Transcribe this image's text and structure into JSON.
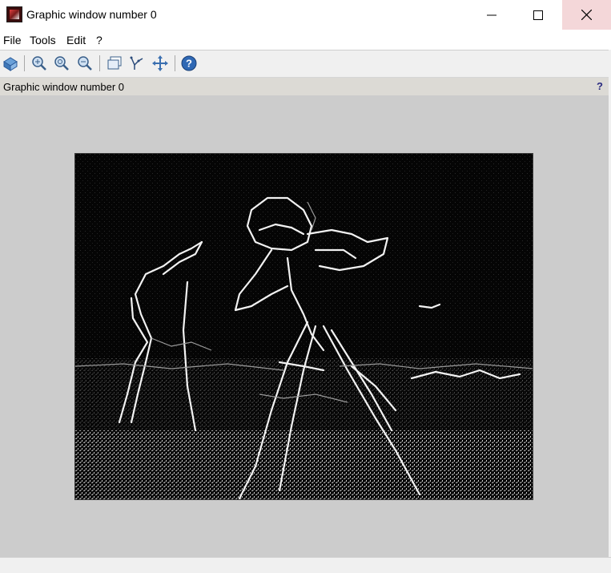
{
  "window": {
    "title": "Graphic window number 0"
  },
  "menu": {
    "items": [
      "File",
      "Tools",
      "Edit",
      "?"
    ]
  },
  "toolbar": {
    "icons": [
      "rotate-3d-icon",
      "zoom-in-icon",
      "zoom-original-icon",
      "zoom-out-icon",
      "datatip-icon",
      "edit-axes-icon",
      "pan-icon",
      "help-icon"
    ]
  },
  "infobar": {
    "text": "Graphic window number 0",
    "help": "?"
  },
  "canvas": {
    "background": "#cccccc",
    "image": "edge-detected grayscale image of a cameraman with tripod (white edges on black)"
  }
}
